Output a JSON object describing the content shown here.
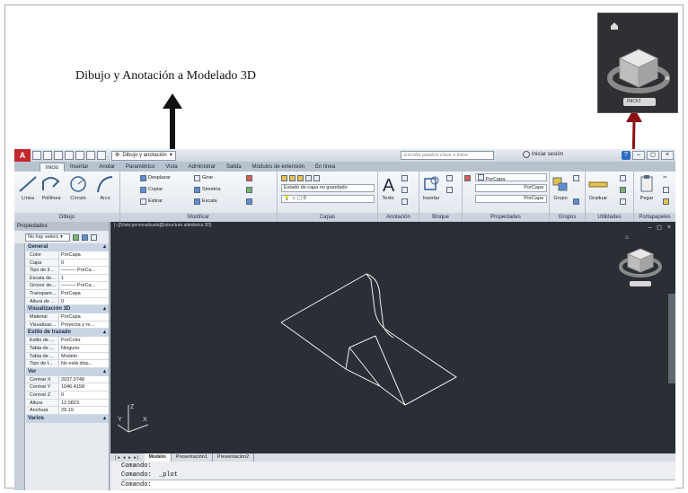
{
  "caption": "Dibujo y Anotación a Modelado 3D",
  "colors": {
    "arrow_up": "#111111",
    "arrow_link": "#8b0f15",
    "viewport_bg": "#2a2e35",
    "logo": "#c4262e"
  },
  "viewcube": {
    "face_label": "SUPERIOR",
    "compass_button": "INICIO"
  },
  "app": {
    "logo": "A",
    "workspace": "Dibujo y anotación",
    "search_placeholder": "Escriba palabra clave o frase",
    "login": "Iniciar sesión",
    "help": "?",
    "ribbon_tabs": [
      "Inicio",
      "Insertar",
      "Anotar",
      "Paramétrico",
      "Vista",
      "Administrar",
      "Salida",
      "Módulos de extensión",
      "En línea"
    ],
    "draw_panel": {
      "tools": [
        "Línea",
        "Polilínea",
        "Círculo",
        "Arco"
      ],
      "footer": "Dibujo"
    },
    "modify_panel": {
      "tools": [
        "Desplazar",
        "Girar",
        "Copiar",
        "Simetría",
        "Estirar",
        "Escala"
      ],
      "footer": "Modificar"
    },
    "layers_panel": {
      "layer_state": "Estado de capa no guardado",
      "current_layer": "0",
      "footer": "Capas"
    },
    "annotation_panel": {
      "tool": "Texto",
      "footer": "Anotación"
    },
    "block_panel": {
      "tool": "Insertar",
      "footer": "Bloque"
    },
    "properties_panel": {
      "color": "PorCapa",
      "linetype": "PorCapa",
      "lineweight": "PorCapa",
      "footer": "Propiedades"
    },
    "groups_panel": {
      "tool": "Grupo",
      "footer": "Grupos"
    },
    "utilities_panel": {
      "tool": "Graduar",
      "footer": "Utilidades"
    },
    "clipboard_panel": {
      "tool": "Pegar",
      "footer": "Portapapeles"
    },
    "properties_palette": {
      "title": "Propiedades",
      "selection": "No hay selecc",
      "sections": [
        {
          "title": "General",
          "rows": [
            {
              "name": "Color",
              "value": "PorCapa"
            },
            {
              "name": "Capa",
              "value": "0"
            },
            {
              "name": "Tipo de lí...",
              "value": "——— PorCa..."
            },
            {
              "name": "Escala de...",
              "value": "1"
            },
            {
              "name": "Grosor de...",
              "value": "——— PorCa..."
            },
            {
              "name": "Transpare...",
              "value": "PorCapa"
            },
            {
              "name": "Altura de ...",
              "value": "0"
            }
          ]
        },
        {
          "title": "Visualización 3D",
          "rows": [
            {
              "name": "Material",
              "value": "PorCapa"
            },
            {
              "name": "Visualizac...",
              "value": "Proyecta y re..."
            }
          ]
        },
        {
          "title": "Estilo de trazado",
          "rows": [
            {
              "name": "Estilo de ...",
              "value": "PorColor"
            },
            {
              "name": "Tabla de ...",
              "value": "Ninguno"
            },
            {
              "name": "Tabla de ...",
              "value": "Modelo"
            },
            {
              "name": "Tipo de t...",
              "value": "No está disp..."
            }
          ]
        },
        {
          "title": "Ver",
          "rows": [
            {
              "name": "Centrar X",
              "value": "2037.0748"
            },
            {
              "name": "Centrar Y",
              "value": "1046.4158"
            },
            {
              "name": "Centrar Z",
              "value": "0"
            },
            {
              "name": "Altura",
              "value": "12.0823"
            },
            {
              "name": "Anchura",
              "value": "29.19"
            }
          ]
        },
        {
          "title": "Varios",
          "rows": []
        }
      ]
    },
    "viewport": {
      "label": "[−][Vista personalizada][Estructura alámbrica 3D]",
      "controls": "– ◻ ×"
    },
    "layout_tabs": [
      "Modelo",
      "Presentación1",
      "Presentación2"
    ],
    "command_lines": [
      "Comando:",
      "Comando:  _plot",
      "Comando:"
    ]
  }
}
